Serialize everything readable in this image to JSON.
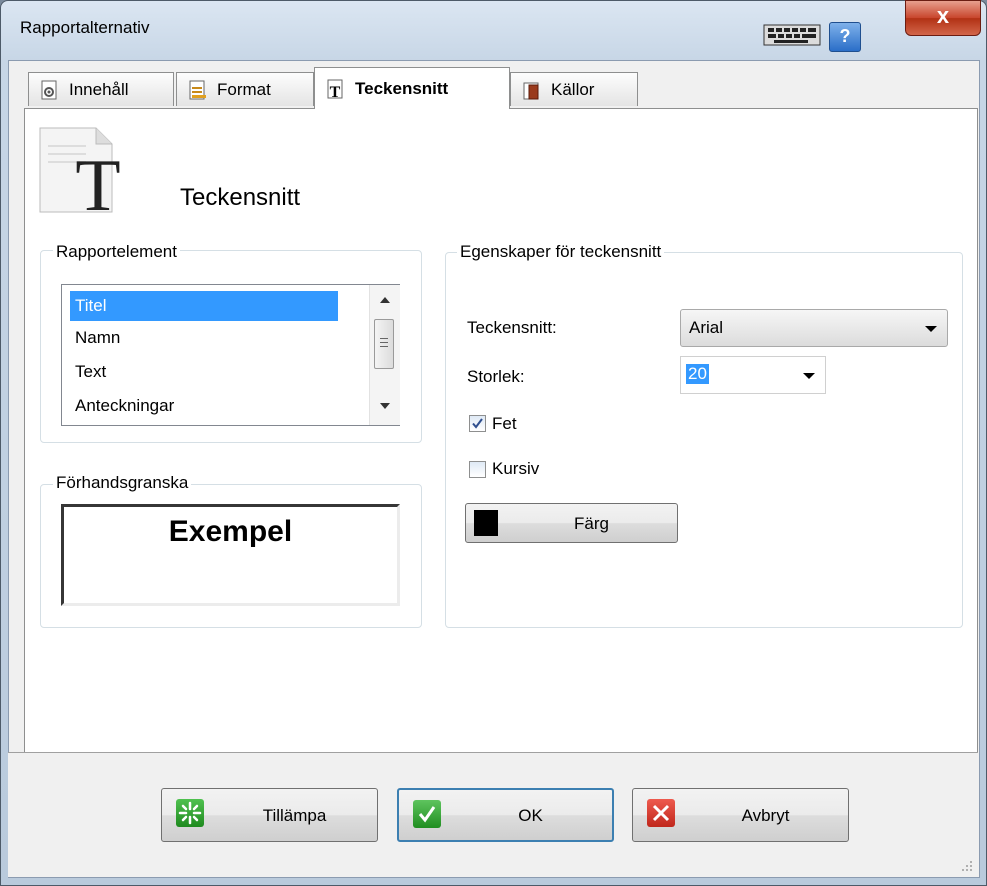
{
  "window": {
    "title": "Rapportalternativ",
    "close_label": "x",
    "help_label": "?"
  },
  "tabs": [
    {
      "label": "Innehåll",
      "icon": "gear-document-icon",
      "active": false
    },
    {
      "label": "Format",
      "icon": "format-lines-icon",
      "active": false
    },
    {
      "label": "Teckensnitt",
      "icon": "font-t-icon",
      "active": true
    },
    {
      "label": "Källor",
      "icon": "book-icon",
      "active": false
    }
  ],
  "header": {
    "title": "Teckensnitt"
  },
  "report_elements": {
    "label": "Rapportelement",
    "items": [
      "Titel",
      "Namn",
      "Text",
      "Anteckningar"
    ],
    "selected": "Titel"
  },
  "preview": {
    "label": "Förhandsgranska",
    "sample_text": "Exempel"
  },
  "font_props": {
    "label": "Egenskaper för teckensnitt",
    "font_label": "Teckensnitt:",
    "font_value": "Arial",
    "size_label": "Storlek:",
    "size_value": "20",
    "bold_label": "Fet",
    "bold_checked": true,
    "italic_label": "Kursiv",
    "italic_checked": false,
    "color_button_label": "Färg",
    "color_value": "#000000"
  },
  "footer": {
    "apply_label": "Tillämpa",
    "ok_label": "OK",
    "cancel_label": "Avbryt"
  },
  "colors": {
    "selection": "#3399ff",
    "ok_green": "#2f9a2f",
    "cancel_red": "#d8322a"
  }
}
